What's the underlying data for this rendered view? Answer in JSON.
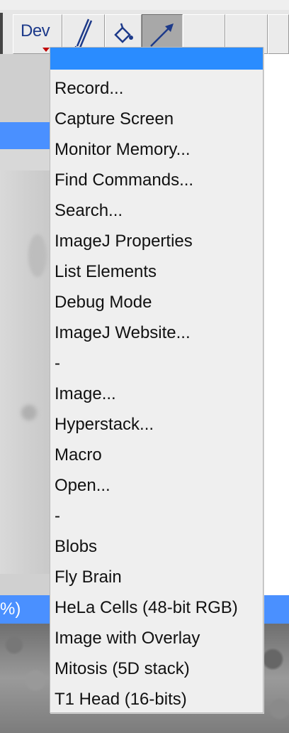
{
  "toolbar": {
    "dev_label": "Dev",
    "buttons": [
      "dev-menu",
      "brush-tool",
      "flood-fill-tool",
      "arrow-tool",
      "empty",
      "empty",
      "empty"
    ]
  },
  "background_window": {
    "status_fragment": "%)"
  },
  "menu": {
    "items": [
      "Record...",
      "Capture Screen",
      "Monitor Memory...",
      "Find Commands...",
      "Search...",
      "ImageJ Properties",
      "List Elements",
      "Debug Mode",
      "ImageJ Website...",
      "-",
      "Image...",
      "Hyperstack...",
      "Macro",
      "Open...",
      "-",
      "Blobs",
      "Fly Brain",
      "HeLa Cells (48-bit RGB)",
      "Image with Overlay",
      "Mitosis (5D stack)",
      "T1 Head (16-bits)"
    ]
  },
  "colors": {
    "menu_header": "#2a8cff",
    "menu_bg": "#efefef",
    "selection_blue": "#4a90ff",
    "dev_text": "#1d3a8a",
    "menu_indicator": "#c00000"
  }
}
